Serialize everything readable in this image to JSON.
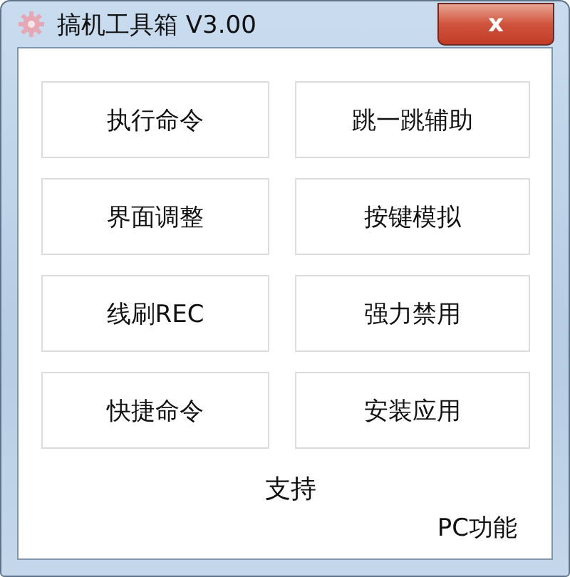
{
  "window": {
    "title": "搞机工具箱 V3.00",
    "close_label": "x"
  },
  "buttons": [
    {
      "label": "执行命令"
    },
    {
      "label": "跳一跳辅助"
    },
    {
      "label": "界面调整"
    },
    {
      "label": "按键模拟"
    },
    {
      "label": "线刷REC"
    },
    {
      "label": "强力禁用"
    },
    {
      "label": "快捷命令"
    },
    {
      "label": "安装应用"
    }
  ],
  "support_label": "支持",
  "pc_label": "PC功能"
}
